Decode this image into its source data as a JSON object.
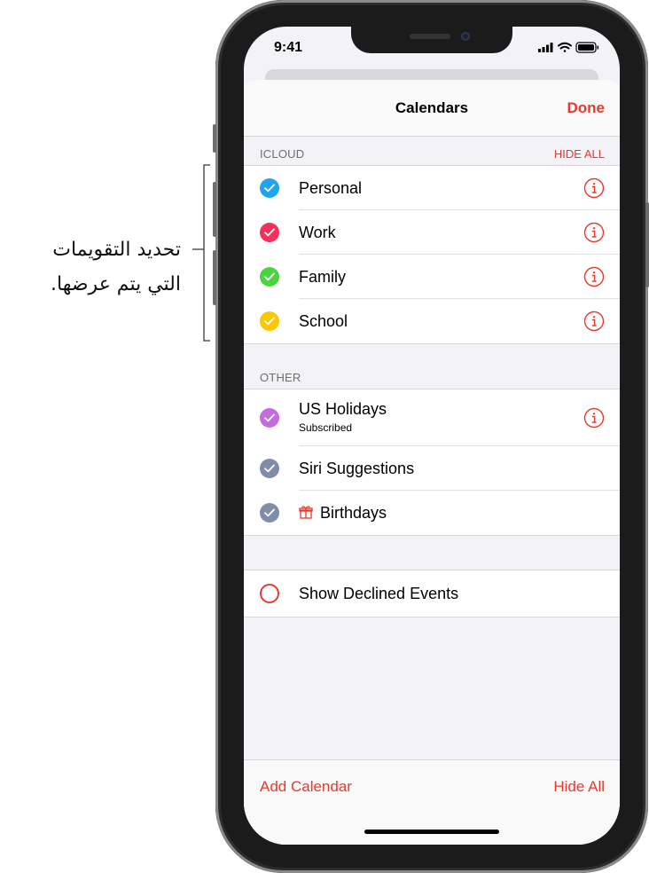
{
  "callout": {
    "line1": "تحديد التقويمات",
    "line2": "التي يتم عرضها."
  },
  "status_bar": {
    "time": "9:41"
  },
  "nav": {
    "title": "Calendars",
    "done_label": "Done"
  },
  "icloud": {
    "header": "ICLOUD",
    "hide_all": "HIDE ALL",
    "items": [
      {
        "label": "Personal",
        "color": "#1fa4f2",
        "checked": true,
        "info": true
      },
      {
        "label": "Work",
        "color": "#f72f5b",
        "checked": true,
        "info": true
      },
      {
        "label": "Family",
        "color": "#4cd43f",
        "checked": true,
        "info": true
      },
      {
        "label": "School",
        "color": "#fdc700",
        "checked": true,
        "info": true
      }
    ]
  },
  "other": {
    "header": "OTHER",
    "items": [
      {
        "label": "US Holidays",
        "sublabel": "Subscribed",
        "color": "#c66bdf",
        "checked": true,
        "info": true
      },
      {
        "label": "Siri Suggestions",
        "color": "#7f8da8",
        "checked": true,
        "info": false
      },
      {
        "label": "Birthdays",
        "color": "#7f8da8",
        "checked": true,
        "info": false,
        "icon": "gift-icon"
      }
    ]
  },
  "declined": {
    "label": "Show Declined Events",
    "checked": false,
    "ring_color": "#e8392e"
  },
  "bottom": {
    "add_calendar": "Add Calendar",
    "hide_all": "Hide All"
  },
  "colors": {
    "accent": "#e8392e"
  }
}
